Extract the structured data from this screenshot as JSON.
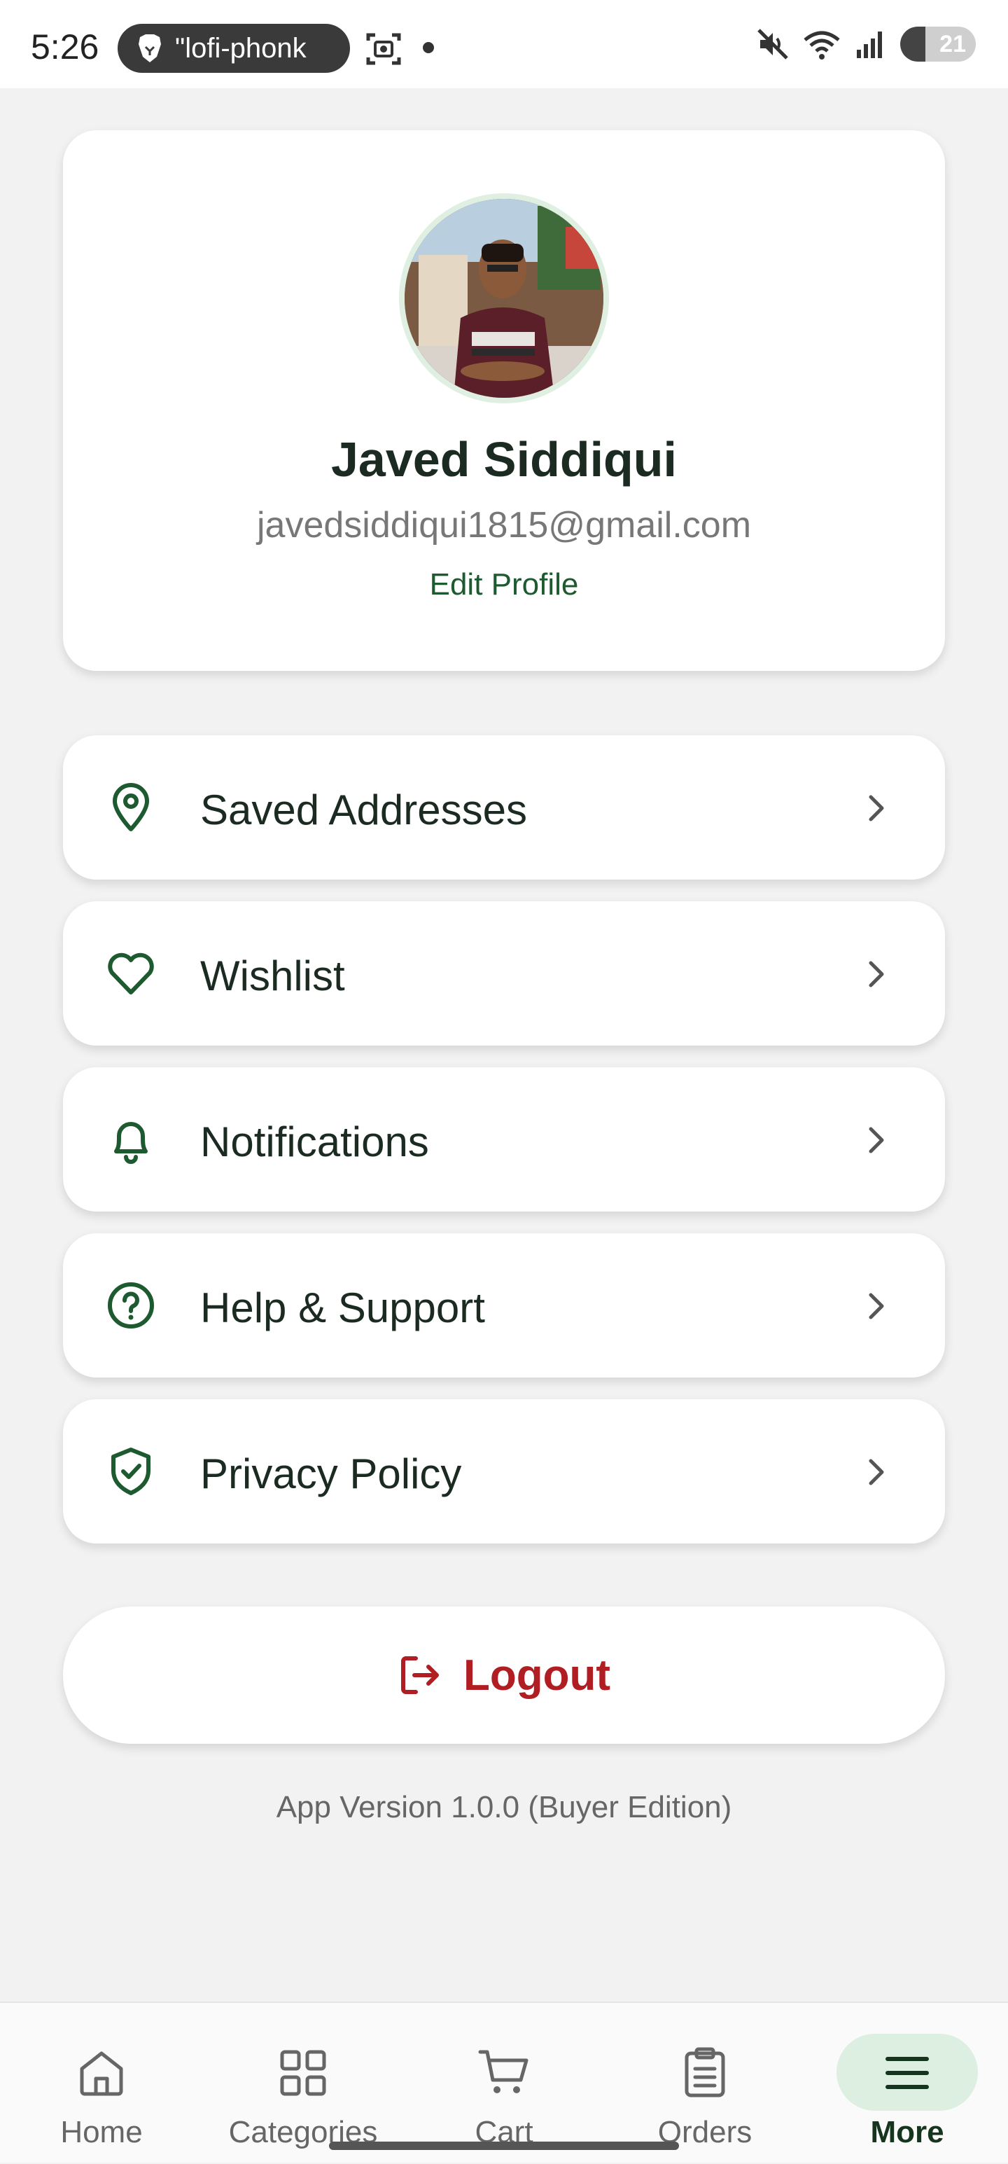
{
  "status_bar": {
    "time": "5:26",
    "media_text": "\"lofi-phonk",
    "battery": "21"
  },
  "profile": {
    "name": "Javed Siddiqui",
    "email": "javedsiddiqui1815@gmail.com",
    "edit_label": "Edit Profile"
  },
  "menu": [
    {
      "label": "Saved Addresses",
      "icon": "map-pin-icon"
    },
    {
      "label": "Wishlist",
      "icon": "heart-icon"
    },
    {
      "label": "Notifications",
      "icon": "bell-icon"
    },
    {
      "label": "Help & Support",
      "icon": "help-circle-icon"
    },
    {
      "label": "Privacy Policy",
      "icon": "shield-check-icon"
    }
  ],
  "logout_label": "Logout",
  "app_version": "App Version 1.0.0 (Buyer Edition)",
  "bottom_nav": [
    {
      "label": "Home",
      "icon": "home-icon"
    },
    {
      "label": "Categories",
      "icon": "grid-icon"
    },
    {
      "label": "Cart",
      "icon": "cart-icon"
    },
    {
      "label": "Orders",
      "icon": "clipboard-icon"
    },
    {
      "label": "More",
      "icon": "menu-icon",
      "active": true
    }
  ],
  "colors": {
    "accent": "#1e5a2f",
    "logout": "#b01e23",
    "active_pill": "#dcefe0",
    "background": "#f2f2f2"
  }
}
